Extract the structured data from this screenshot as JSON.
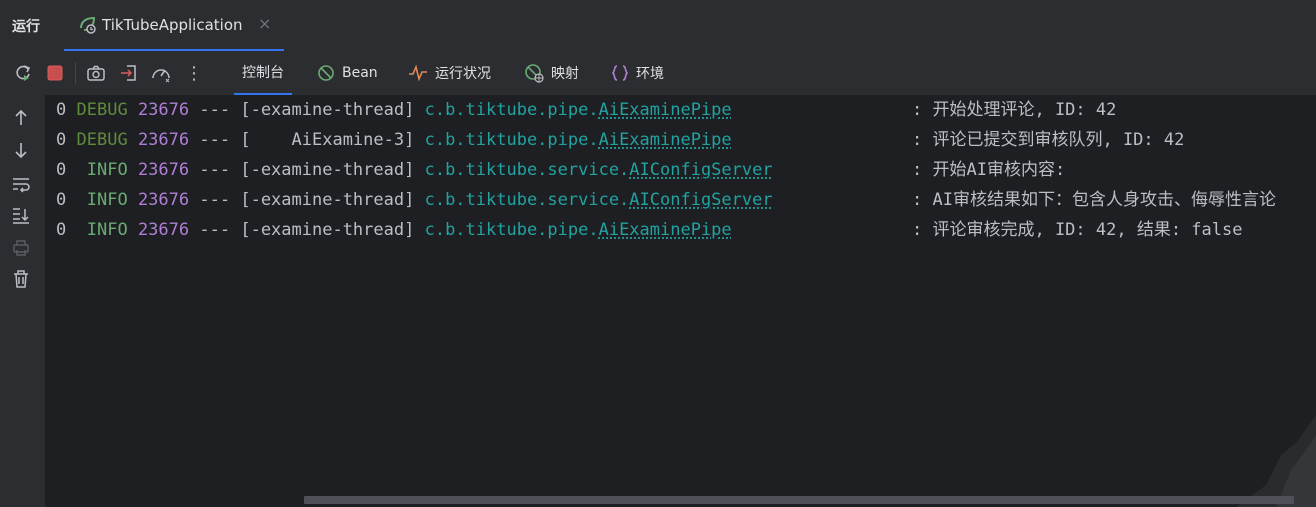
{
  "tool_window": {
    "title": "运行"
  },
  "run_tab": {
    "label": "TikTubeApplication",
    "close": "×"
  },
  "toolbar": {
    "buttons": [
      "rerun-icon",
      "stop-icon",
      "camera-icon",
      "exit-icon",
      "gauge-icon",
      "more-icon"
    ],
    "more_glyph": "⋮",
    "tabs": [
      {
        "label": "控制台",
        "icon": "",
        "active": true
      },
      {
        "label": "Bean",
        "icon": "bean-icon",
        "active": false
      },
      {
        "label": "运行状况",
        "icon": "health-icon",
        "active": false
      },
      {
        "label": "映射",
        "icon": "mapping-icon",
        "active": false
      },
      {
        "label": "环境",
        "icon": "environment-icon",
        "active": false
      }
    ]
  },
  "gutter": {
    "buttons": [
      "arrow-up-icon",
      "arrow-down-icon",
      "soft-wrap-icon",
      "scroll-to-end-icon",
      "print-icon",
      "trash-icon"
    ]
  },
  "console": {
    "lines": [
      {
        "prefix": "0",
        "level": "DEBUG",
        "pid": "23676",
        "sep": "---",
        "thread": "[-examine-thread]",
        "pkg": "c.b.tiktube.pipe.",
        "cls": "AiExaminePipe",
        "msg": ": 开始处理评论, ID: 42"
      },
      {
        "prefix": "0",
        "level": "DEBUG",
        "pid": "23676",
        "sep": "---",
        "thread": "[    AiExamine-3]",
        "pkg": "c.b.tiktube.pipe.",
        "cls": "AiExaminePipe",
        "msg": ": 评论已提交到审核队列, ID: 42"
      },
      {
        "prefix": "0",
        "level": " INFO",
        "pid": "23676",
        "sep": "---",
        "thread": "[-examine-thread]",
        "pkg": "c.b.tiktube.service.",
        "cls": "AIConfigServer",
        "msg": ": 开始AI审核内容:"
      },
      {
        "prefix": "0",
        "level": " INFO",
        "pid": "23676",
        "sep": "---",
        "thread": "[-examine-thread]",
        "pkg": "c.b.tiktube.service.",
        "cls": "AIConfigServer",
        "msg": ": AI审核结果如下：包含人身攻击、侮辱性言论"
      },
      {
        "prefix": "0",
        "level": " INFO",
        "pid": "23676",
        "sep": "---",
        "thread": "[-examine-thread]",
        "pkg": "c.b.tiktube.pipe.",
        "cls": "AiExaminePipe",
        "msg": ": 评论审核完成, ID: 42, 结果: false"
      }
    ]
  },
  "colors": {
    "background": "#1e1f22",
    "panel": "#2b2d30",
    "accent": "#3574f0",
    "debug": "#5f8c3b",
    "info": "#6aab73",
    "pid": "#b07fd5",
    "logger": "#20a3a1",
    "stop": "#db5c5c"
  }
}
